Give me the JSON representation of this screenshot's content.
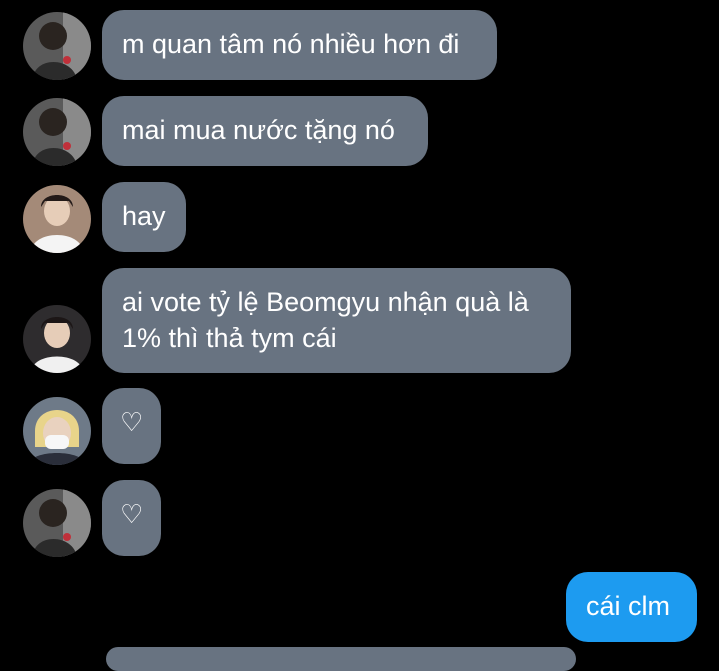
{
  "messages": [
    {
      "sender": "friend-a",
      "text": "m quan tâm nó nhiều hơn đi"
    },
    {
      "sender": "friend-a",
      "text": "mai mua nước tặng nó"
    },
    {
      "sender": "friend-b",
      "text": "hay"
    },
    {
      "sender": "friend-b",
      "text": "ai vote tỷ lệ Beomgyu nhận quà là\n1% thì thả tym cái"
    },
    {
      "sender": "friend-c",
      "text": "♡"
    },
    {
      "sender": "friend-a",
      "text": "♡"
    },
    {
      "sender": "me",
      "text": "cái clm"
    }
  ],
  "colors": {
    "background": "#000000",
    "incoming_bubble": "#687381",
    "outgoing_bubble": "#1d9bf0",
    "text": "#ffffff"
  },
  "icons": {
    "friend_a_avatar": "avatar-dark-hair-icon",
    "friend_b_avatar": "avatar-white-shirt-icon",
    "friend_c_avatar": "avatar-blonde-mask-icon"
  }
}
